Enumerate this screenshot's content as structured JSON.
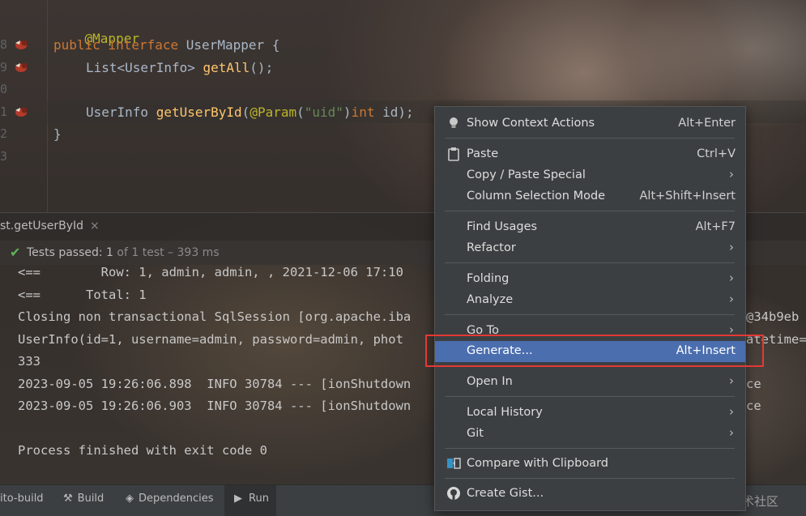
{
  "editor": {
    "line_numbers": [
      "8",
      "9",
      "0",
      "1",
      "2",
      "3"
    ],
    "lines": {
      "l1": {
        "annotation": "@Mapper"
      },
      "l2": {
        "kw1": "public",
        "kw2": "interface",
        "name": "UserMapper",
        "brace": "{"
      },
      "l3": {
        "type": "List<UserInfo>",
        "method": "getAll",
        "rest": "();"
      },
      "l5": {
        "type": "UserInfo",
        "method": "getUserById",
        "p1": "(",
        "ann": "@Param",
        "p2": "(",
        "str": "\"uid\"",
        "p3": ")",
        "kw": "int",
        "rest": " id);"
      },
      "l6": {
        "brace": "}"
      }
    }
  },
  "run_panel": {
    "tab_label": "st.getUserById",
    "tab_close": "×",
    "status": {
      "prefix": "Tests passed:",
      "count": "1",
      "suffix": "of 1 test – 393 ms"
    },
    "console_lines": [
      "<==        Row: 1, admin, admin, , 2021-12-06 17:10",
      "<==      Total: 1",
      "Closing non transactional SqlSession [org.apache.iba",
      "UserInfo(id=1, username=admin, password=admin, phot",
      "333",
      "2023-09-05 19:26:06.898  INFO 30784 --- [ionShutdown",
      "2023-09-05 19:26:06.903  INFO 30784 --- [ionShutdown",
      "",
      "Process finished with exit code 0"
    ],
    "right_fragments": [
      "@34b9eb",
      "atetime=",
      "ce",
      "ce"
    ]
  },
  "bottom_tabs": {
    "auto_build": "ito-build",
    "build": "Build",
    "dependencies": "Dependencies",
    "run": "Run"
  },
  "watermark": "@稀土掘金技术社区",
  "context_menu": {
    "show_context_actions": {
      "label": "Show Context Actions",
      "shortcut": "Alt+Enter"
    },
    "paste": {
      "label": "Paste",
      "shortcut": "Ctrl+V"
    },
    "copy_paste_special": {
      "label": "Copy / Paste Special"
    },
    "column_selection_mode": {
      "label": "Column Selection Mode",
      "shortcut": "Alt+Shift+Insert"
    },
    "find_usages": {
      "label": "Find Usages",
      "shortcut": "Alt+F7"
    },
    "refactor": {
      "label": "Refactor"
    },
    "folding": {
      "label": "Folding"
    },
    "analyze": {
      "label": "Analyze"
    },
    "go_to": {
      "label": "Go To"
    },
    "generate": {
      "label": "Generate...",
      "shortcut": "Alt+Insert"
    },
    "open_in": {
      "label": "Open In"
    },
    "local_history": {
      "label": "Local History"
    },
    "git": {
      "label": "Git"
    },
    "compare_clipboard": {
      "label": "Compare with Clipboard"
    },
    "create_gist": {
      "label": "Create Gist..."
    },
    "submenu_arrow": "›"
  },
  "colors": {
    "selection": "#4b6eaf",
    "highlight_box": "#e53935",
    "menu_bg": "#3c3f41"
  }
}
